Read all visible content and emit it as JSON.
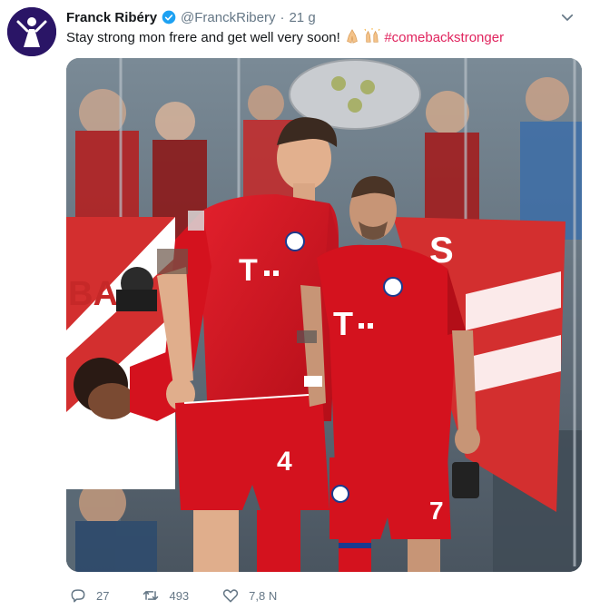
{
  "tweet": {
    "display_name": "Franck Ribéry",
    "handle": "@FranckRibery",
    "separator": "·",
    "time": "21 g",
    "text": "Stay strong mon frere and get well very soon!",
    "hashtag": "#comebackstronger",
    "emojis": [
      "folded-hands-icon",
      "raised-hands-icon"
    ]
  },
  "photo": {
    "jersey_text_left": "T",
    "jersey_text_right": "T",
    "left_number": "4",
    "right_number": "7",
    "banner_letters_left": "BA",
    "banner_letters_right": "S"
  },
  "actions": {
    "replies": "27",
    "retweets": "493",
    "likes": "7,8 N"
  },
  "colors": {
    "hashtag": "#e0245e",
    "muted": "#657786",
    "verified": "#1da1f2",
    "jersey_red": "#d4121e",
    "avatar_bg": "#2a1566"
  }
}
